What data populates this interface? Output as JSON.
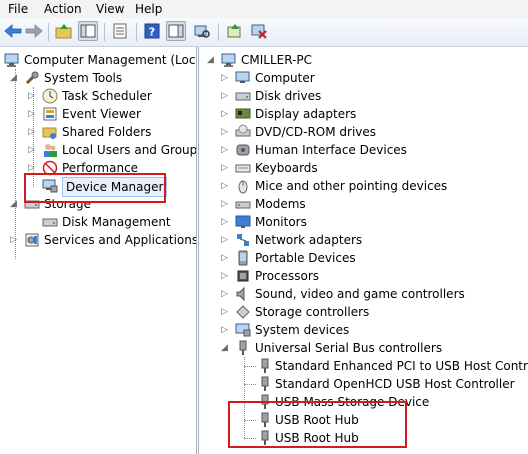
{
  "menu": [
    "File",
    "Action",
    "View",
    "Help"
  ],
  "toolbar": {
    "buttons": [
      "back-icon",
      "forward-icon",
      "up-folder-icon",
      "show-hide-tree-icon",
      "properties-icon",
      "help-icon",
      "console-tree-icon",
      "scan-hardware-icon",
      "update-driver-icon",
      "uninstall-icon"
    ]
  },
  "left_tree": {
    "root": "Computer Management (Local",
    "system_tools": "System Tools",
    "task_scheduler": "Task Scheduler",
    "event_viewer": "Event Viewer",
    "shared_folders": "Shared Folders",
    "local_users": "Local Users and Groups",
    "performance": "Performance",
    "device_manager": "Device Manager",
    "storage": "Storage",
    "disk_management": "Disk Management",
    "services": "Services and Applications"
  },
  "right_tree": {
    "root": "CMILLER-PC",
    "categories": [
      "Computer",
      "Disk drives",
      "Display adapters",
      "DVD/CD-ROM drives",
      "Human Interface Devices",
      "Keyboards",
      "Mice and other pointing devices",
      "Modems",
      "Monitors",
      "Network adapters",
      "Portable Devices",
      "Processors",
      "Sound, video and game controllers",
      "Storage controllers",
      "System devices",
      "Universal Serial Bus controllers"
    ],
    "usb_children": [
      "Standard Enhanced PCI to USB Host Controller",
      "Standard OpenHCD USB Host Controller",
      "USB Mass Storage Device",
      "USB Root Hub",
      "USB Root Hub"
    ]
  },
  "colors": {
    "highlight": "#d21c1c",
    "selection": "#e8f0fb"
  }
}
